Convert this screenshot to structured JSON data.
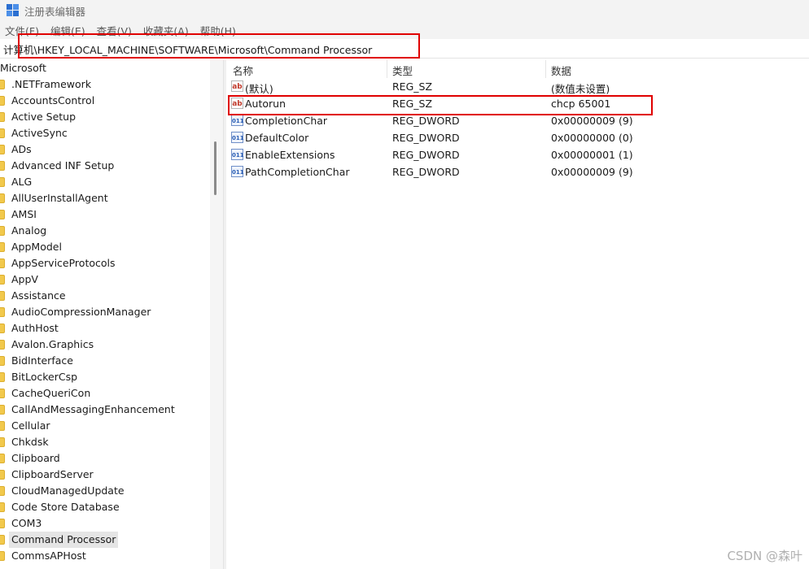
{
  "window": {
    "title": "注册表编辑器"
  },
  "menu": [
    "文件(F)",
    "编辑(E)",
    "查看(V)",
    "收藏夹(A)",
    "帮助(H)"
  ],
  "address": "计算机\\HKEY_LOCAL_MACHINE\\SOFTWARE\\Microsoft\\Command Processor",
  "tree": {
    "root": "Microsoft",
    "items": [
      ".NETFramework",
      "AccountsControl",
      "Active Setup",
      "ActiveSync",
      "ADs",
      "Advanced INF Setup",
      "ALG",
      "AllUserInstallAgent",
      "AMSI",
      "Analog",
      "AppModel",
      "AppServiceProtocols",
      "AppV",
      "Assistance",
      "AudioCompressionManager",
      "AuthHost",
      "Avalon.Graphics",
      "BidInterface",
      "BitLockerCsp",
      "CacheQueriCon",
      "CallAndMessagingEnhancement",
      "Cellular",
      "Chkdsk",
      "Clipboard",
      "ClipboardServer",
      "CloudManagedUpdate",
      "Code Store Database",
      "COM3",
      "Command Processor",
      "CommsAPHost"
    ],
    "selected": "Command Processor"
  },
  "columns": {
    "name": "名称",
    "type": "类型",
    "data": "数据"
  },
  "values": [
    {
      "icon": "string-value-icon",
      "name": "(默认)",
      "type": "REG_SZ",
      "data": "(数值未设置)"
    },
    {
      "icon": "string-value-icon",
      "name": "Autorun",
      "type": "REG_SZ",
      "data": "chcp 65001"
    },
    {
      "icon": "binary-value-icon",
      "name": "CompletionChar",
      "type": "REG_DWORD",
      "data": "0x00000009 (9)"
    },
    {
      "icon": "binary-value-icon",
      "name": "DefaultColor",
      "type": "REG_DWORD",
      "data": "0x00000000 (0)"
    },
    {
      "icon": "binary-value-icon",
      "name": "EnableExtensions",
      "type": "REG_DWORD",
      "data": "0x00000001 (1)"
    },
    {
      "icon": "binary-value-icon",
      "name": "PathCompletionChar",
      "type": "REG_DWORD",
      "data": "0x00000009 (9)"
    }
  ],
  "watermark": "CSDN @森叶",
  "colors": {
    "highlight_box": "#e00000",
    "folder": "#f2c94c",
    "selection": "#e5e5e5"
  }
}
